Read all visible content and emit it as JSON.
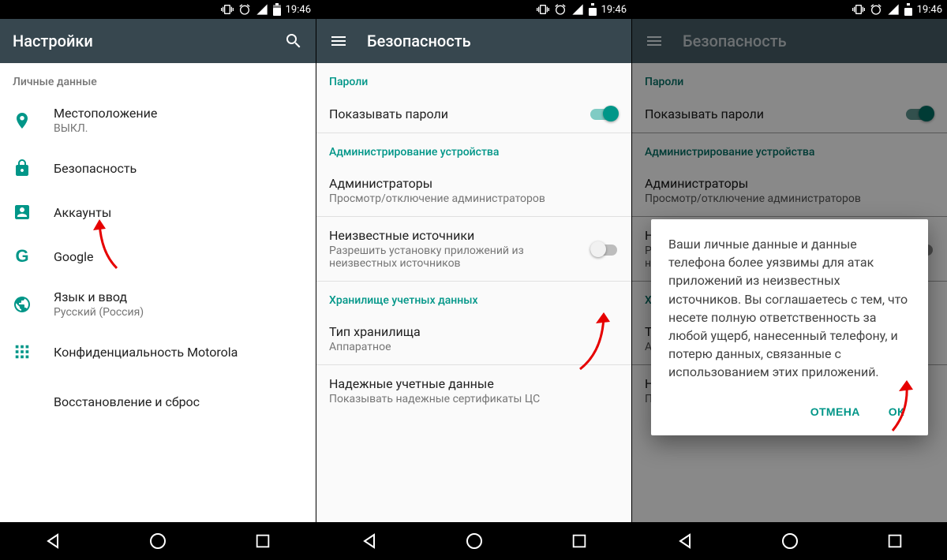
{
  "status": {
    "time": "19:46"
  },
  "nav": {
    "back": "back",
    "home": "home",
    "recent": "recent"
  },
  "screen1": {
    "title": "Настройки",
    "section": "Личные данные",
    "items": [
      {
        "icon": "location",
        "title": "Местоположение",
        "sub": "ВЫКЛ."
      },
      {
        "icon": "lock",
        "title": "Безопасность",
        "sub": ""
      },
      {
        "icon": "account",
        "title": "Аккаунты",
        "sub": ""
      },
      {
        "icon": "google",
        "title": "Google",
        "sub": ""
      },
      {
        "icon": "language",
        "title": "Язык и ввод",
        "sub": "Русский (Россия)"
      },
      {
        "icon": "privacy",
        "title": "Конфиденциальность Motorola",
        "sub": ""
      },
      {
        "icon": "restore",
        "title": "Восстановление и сброс",
        "sub": ""
      }
    ]
  },
  "screen2": {
    "title": "Безопасность",
    "sections": {
      "passwords": "Пароли",
      "admin": "Администрирование устройства",
      "credstore": "Хранилище учетных данных"
    },
    "rows": {
      "show_passwords": {
        "title": "Показывать пароли",
        "on": true
      },
      "admins": {
        "title": "Администраторы",
        "sub": "Просмотр/отключение администраторов"
      },
      "unknown": {
        "title": "Неизвестные источники",
        "sub": "Разрешить установку приложений из неизвестных источников",
        "on": false
      },
      "storage_type": {
        "title": "Тип хранилища",
        "sub": "Аппаратное"
      },
      "trusted": {
        "title": "Надежные учетные данные",
        "sub": "Показывать надежные сертификаты ЦС"
      }
    }
  },
  "screen3": {
    "title": "Безопасность",
    "dialog": {
      "text": "Ваши личные данные и данные телефона более уязвимы для атак приложений из неизвестных источников. Вы соглашаетесь с тем, что несете полную ответственность за любой ущерб, нанесенный телефону, и потерю данных, связанные с использованием этих приложений.",
      "cancel": "ОТМЕНА",
      "ok": "ОК"
    }
  }
}
